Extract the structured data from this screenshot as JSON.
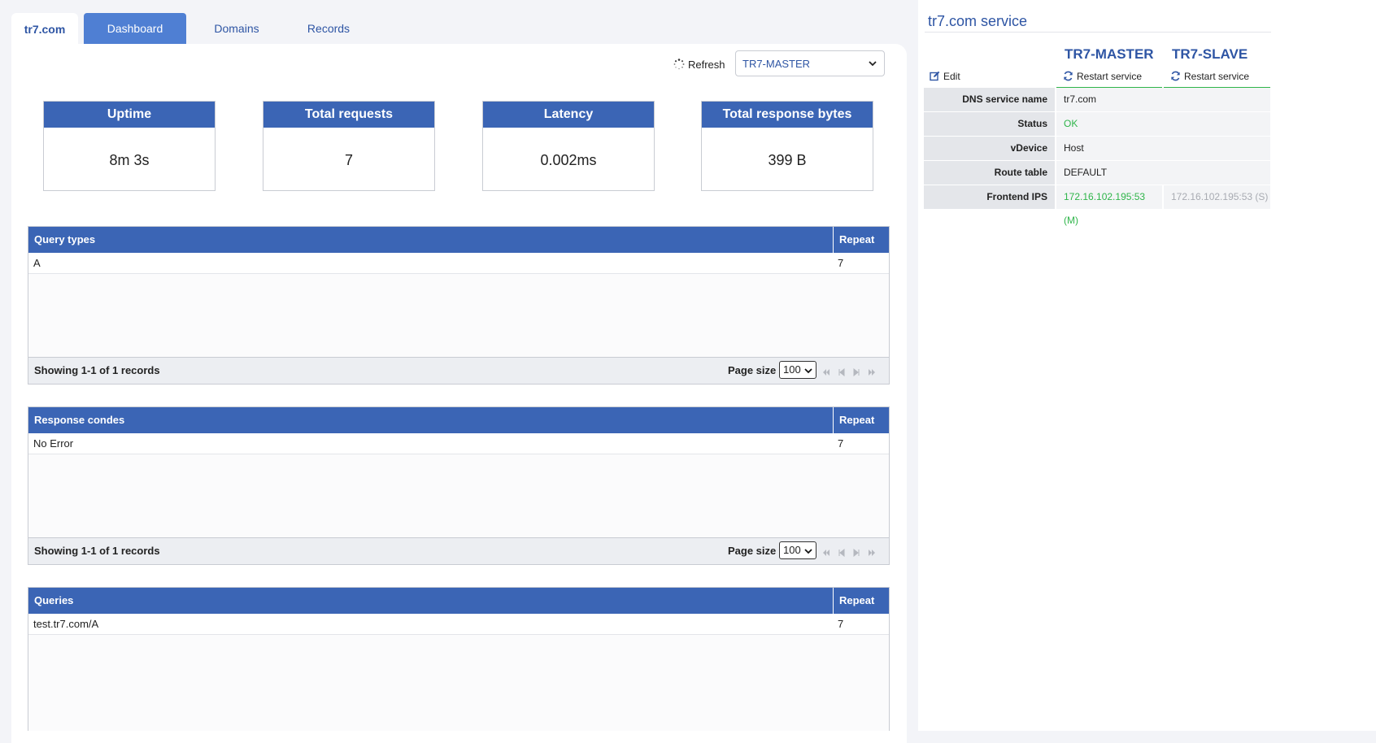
{
  "tabs": {
    "brand": "tr7.com",
    "dashboard": "Dashboard",
    "domains": "Domains",
    "records": "Records"
  },
  "toolbar": {
    "refresh_label": "Refresh",
    "node_select_value": "TR7-MASTER"
  },
  "stats": [
    {
      "label": "Uptime",
      "value": "8m 3s"
    },
    {
      "label": "Total requests",
      "value": "7"
    },
    {
      "label": "Latency",
      "value": "0.002ms"
    },
    {
      "label": "Total response bytes",
      "value": "399 B"
    }
  ],
  "tables": {
    "query_types": {
      "col1": "Query types",
      "col2": "Repeat",
      "rows": [
        {
          "name": "A",
          "repeat": "7"
        }
      ],
      "showing": "Showing 1-1 of 1 records",
      "page_size_label": "Page size :",
      "page_size": "100"
    },
    "response_codes": {
      "col1": "Response condes",
      "col2": "Repeat",
      "rows": [
        {
          "name": "No Error",
          "repeat": "7"
        }
      ],
      "showing": "Showing 1-1 of 1 records",
      "page_size_label": "Page size :",
      "page_size": "100"
    },
    "queries": {
      "col1": "Queries",
      "col2": "Repeat",
      "rows": [
        {
          "name": "test.tr7.com/A",
          "repeat": "7"
        }
      ]
    }
  },
  "sidebar": {
    "title": "tr7.com service",
    "master_name": "TR7-MASTER",
    "slave_name": "TR7-SLAVE",
    "edit_label": "Edit",
    "restart_label": "Restart service",
    "props": {
      "dns_name_label": "DNS service name",
      "dns_name_value": "tr7.com",
      "status_label": "Status",
      "status_value": "OK",
      "vdevice_label": "vDevice",
      "vdevice_value": "Host",
      "route_label": "Route table",
      "route_value": "DEFAULT",
      "frontend_label": "Frontend IPS",
      "frontend_master": "172.16.102.195:53 (M)",
      "frontend_slave": "172.16.102.195:53 (S)"
    }
  },
  "colors": {
    "accent": "#3b65b5",
    "tab_active": "#4f7fd3",
    "link": "#2e55a4",
    "ok": "#2fb54a"
  }
}
